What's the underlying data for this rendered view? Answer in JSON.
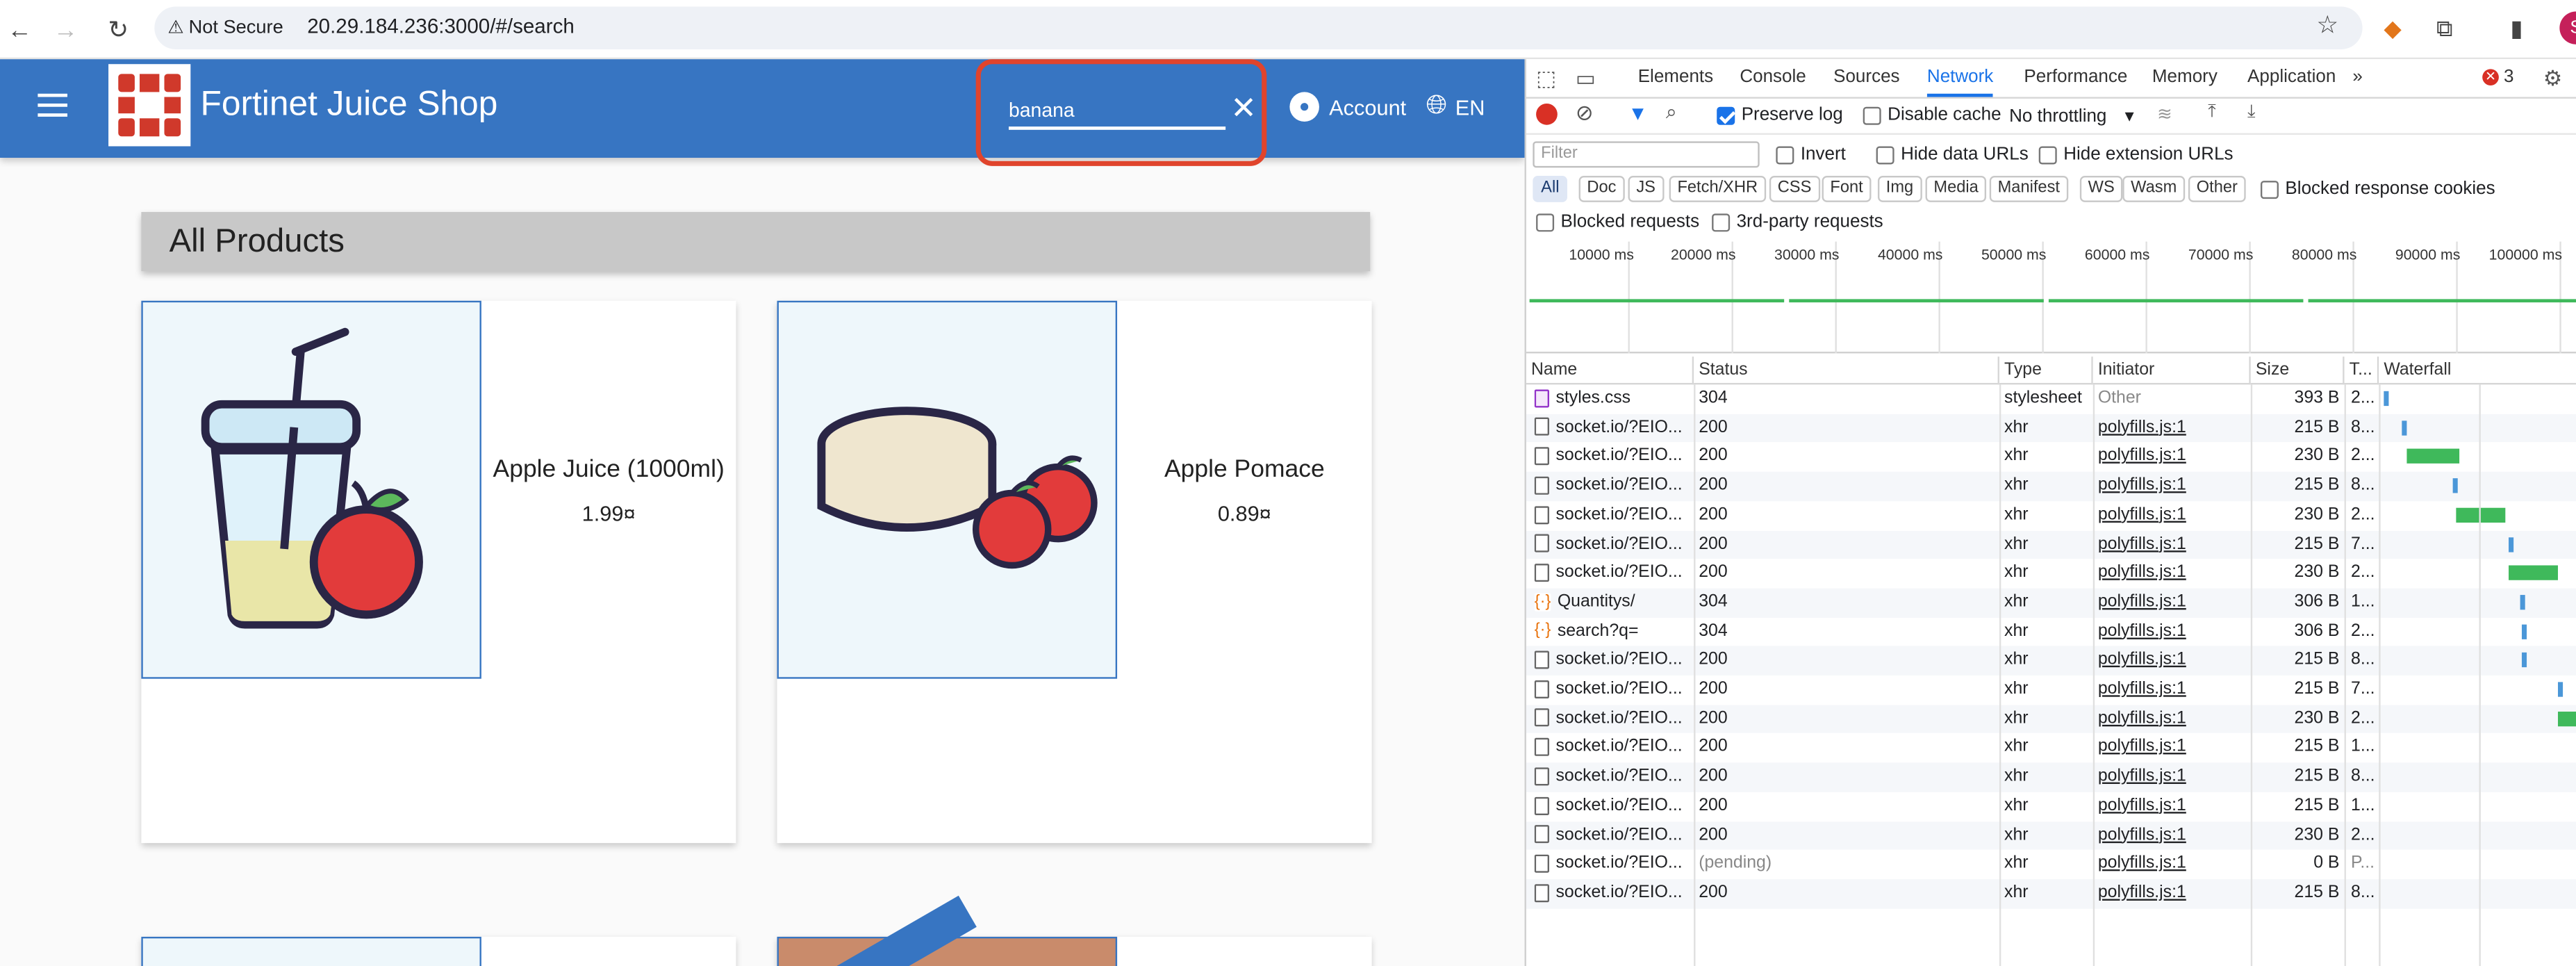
{
  "browser": {
    "security_label": "Not Secure",
    "url": "20.29.184.236:3000/#/search",
    "profile_initial": "S"
  },
  "app": {
    "title": "Fortinet Juice Shop",
    "search_value": "banana",
    "account_label": "Account",
    "language_label": "EN",
    "heading": "All Products",
    "products": [
      {
        "name": "Apple Juice (1000ml)",
        "price": "1.99¤"
      },
      {
        "name": "Apple Pomace",
        "price": "0.89¤"
      }
    ],
    "colors": {
      "toolbar": "#3775c2",
      "highlight": "#e0442c"
    }
  },
  "devtools": {
    "tabs": [
      "Elements",
      "Console",
      "Sources",
      "Network",
      "Performance",
      "Memory",
      "Application"
    ],
    "active_tab": "Network",
    "more_tabs": "»",
    "error_count": "3",
    "preserve_log": "Preserve log",
    "disable_cache": "Disable cache",
    "throttling": "No throttling",
    "filter_placeholder": "Filter",
    "invert": "Invert",
    "hide_data_urls": "Hide data URLs",
    "hide_extension_urls": "Hide extension URLs",
    "type_filters": [
      "All",
      "Doc",
      "JS",
      "Fetch/XHR",
      "CSS",
      "Font",
      "Img",
      "Media",
      "Manifest",
      "WS",
      "Wasm",
      "Other"
    ],
    "blocked_response_cookies": "Blocked response cookies",
    "blocked_requests": "Blocked requests",
    "third_party_requests": "3rd-party requests",
    "timeline_labels": [
      "10000 ms",
      "20000 ms",
      "30000 ms",
      "40000 ms",
      "50000 ms",
      "60000 ms",
      "70000 ms",
      "80000 ms",
      "90000 ms",
      "100000 ms"
    ],
    "columns": [
      "Name",
      "Status",
      "Type",
      "Initiator",
      "Size",
      "T...",
      "Waterfall"
    ],
    "rows": [
      {
        "name": "styles.css",
        "status": "304",
        "type": "stylesheet",
        "initiator": "Other",
        "size": "393 B",
        "time": "2...",
        "icon": "css"
      },
      {
        "name": "socket.io/?EIO...",
        "status": "200",
        "type": "xhr",
        "initiator": "polyfills.js:1",
        "size": "215 B",
        "time": "8...",
        "icon": "file"
      },
      {
        "name": "socket.io/?EIO...",
        "status": "200",
        "type": "xhr",
        "initiator": "polyfills.js:1",
        "size": "230 B",
        "time": "2...",
        "icon": "file"
      },
      {
        "name": "socket.io/?EIO...",
        "status": "200",
        "type": "xhr",
        "initiator": "polyfills.js:1",
        "size": "215 B",
        "time": "8...",
        "icon": "file"
      },
      {
        "name": "socket.io/?EIO...",
        "status": "200",
        "type": "xhr",
        "initiator": "polyfills.js:1",
        "size": "230 B",
        "time": "2...",
        "icon": "file"
      },
      {
        "name": "socket.io/?EIO...",
        "status": "200",
        "type": "xhr",
        "initiator": "polyfills.js:1",
        "size": "215 B",
        "time": "7...",
        "icon": "file"
      },
      {
        "name": "socket.io/?EIO...",
        "status": "200",
        "type": "xhr",
        "initiator": "polyfills.js:1",
        "size": "230 B",
        "time": "2...",
        "icon": "file"
      },
      {
        "name": "Quantitys/",
        "status": "304",
        "type": "xhr",
        "initiator": "polyfills.js:1",
        "size": "306 B",
        "time": "1...",
        "icon": "json"
      },
      {
        "name": "search?q=",
        "status": "304",
        "type": "xhr",
        "initiator": "polyfills.js:1",
        "size": "306 B",
        "time": "2...",
        "icon": "json"
      },
      {
        "name": "socket.io/?EIO...",
        "status": "200",
        "type": "xhr",
        "initiator": "polyfills.js:1",
        "size": "215 B",
        "time": "8...",
        "icon": "file"
      },
      {
        "name": "socket.io/?EIO...",
        "status": "200",
        "type": "xhr",
        "initiator": "polyfills.js:1",
        "size": "215 B",
        "time": "7...",
        "icon": "file"
      },
      {
        "name": "socket.io/?EIO...",
        "status": "200",
        "type": "xhr",
        "initiator": "polyfills.js:1",
        "size": "230 B",
        "time": "2...",
        "icon": "file"
      },
      {
        "name": "socket.io/?EIO...",
        "status": "200",
        "type": "xhr",
        "initiator": "polyfills.js:1",
        "size": "215 B",
        "time": "1...",
        "icon": "file"
      },
      {
        "name": "socket.io/?EIO...",
        "status": "200",
        "type": "xhr",
        "initiator": "polyfills.js:1",
        "size": "215 B",
        "time": "8...",
        "icon": "file"
      },
      {
        "name": "socket.io/?EIO...",
        "status": "200",
        "type": "xhr",
        "initiator": "polyfills.js:1",
        "size": "215 B",
        "time": "1...",
        "icon": "file"
      },
      {
        "name": "socket.io/?EIO...",
        "status": "200",
        "type": "xhr",
        "initiator": "polyfills.js:1",
        "size": "230 B",
        "time": "2...",
        "icon": "file"
      },
      {
        "name": "socket.io/?EIO...",
        "status": "(pending)",
        "type": "xhr",
        "initiator": "polyfills.js:1",
        "size": "0 B",
        "time": "P...",
        "icon": "file"
      },
      {
        "name": "socket.io/?EIO...",
        "status": "200",
        "type": "xhr",
        "initiator": "polyfills.js:1",
        "size": "215 B",
        "time": "8...",
        "icon": "file"
      }
    ]
  }
}
